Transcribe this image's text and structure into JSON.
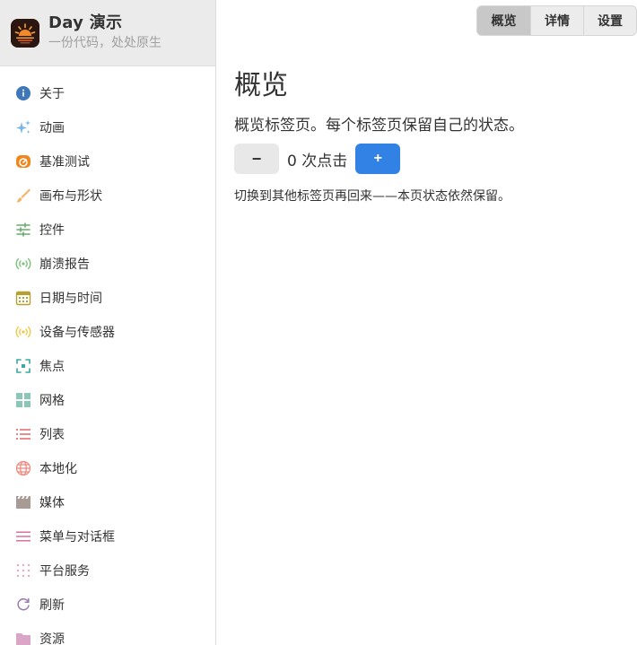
{
  "app": {
    "title": "Day 演示",
    "subtitle": "一份代码，处处原生"
  },
  "sidebar": {
    "items": [
      {
        "label": "关于",
        "icon": "info-icon",
        "color": "#3f77b8"
      },
      {
        "label": "动画",
        "icon": "sparkles-icon",
        "color": "#7ab7e6"
      },
      {
        "label": "基准测试",
        "icon": "speedometer-icon",
        "color": "#f0861e"
      },
      {
        "label": "画布与形状",
        "icon": "brush-icon",
        "color": "#f3b46a"
      },
      {
        "label": "控件",
        "icon": "sliders-icon",
        "color": "#6aa96a"
      },
      {
        "label": "崩溃报告",
        "icon": "broadcast-icon",
        "color": "#7cc27c"
      },
      {
        "label": "日期与时间",
        "icon": "calendar-icon",
        "color": "#b5a030"
      },
      {
        "label": "设备与传感器",
        "icon": "sensor-icon",
        "color": "#f2c84b"
      },
      {
        "label": "焦点",
        "icon": "focus-icon",
        "color": "#3aa7a0"
      },
      {
        "label": "网格",
        "icon": "grid-icon",
        "color": "#8cc6b8"
      },
      {
        "label": "列表",
        "icon": "list-icon",
        "color": "#e25c5c"
      },
      {
        "label": "本地化",
        "icon": "globe-icon",
        "color": "#f08a80"
      },
      {
        "label": "媒体",
        "icon": "clapperboard-icon",
        "color": "#a89a94"
      },
      {
        "label": "菜单与对话框",
        "icon": "menu-icon",
        "color": "#d46a96"
      },
      {
        "label": "平台服务",
        "icon": "dots-grid-icon",
        "color": "#e7a9c2"
      },
      {
        "label": "刷新",
        "icon": "refresh-icon",
        "color": "#9b7bb0"
      },
      {
        "label": "资源",
        "icon": "folder-icon",
        "color": "#d9a6c8"
      }
    ]
  },
  "tabs": [
    {
      "label": "概览",
      "active": true
    },
    {
      "label": "详情",
      "active": false
    },
    {
      "label": "设置",
      "active": false
    }
  ],
  "main": {
    "title": "概览",
    "description": "概览标签页。每个标签页保留自己的状态。",
    "minus_label": "−",
    "count_text": "0 次点击",
    "plus_label": "+",
    "note": "切换到其他标签页再回来——本页状态依然保留。"
  }
}
